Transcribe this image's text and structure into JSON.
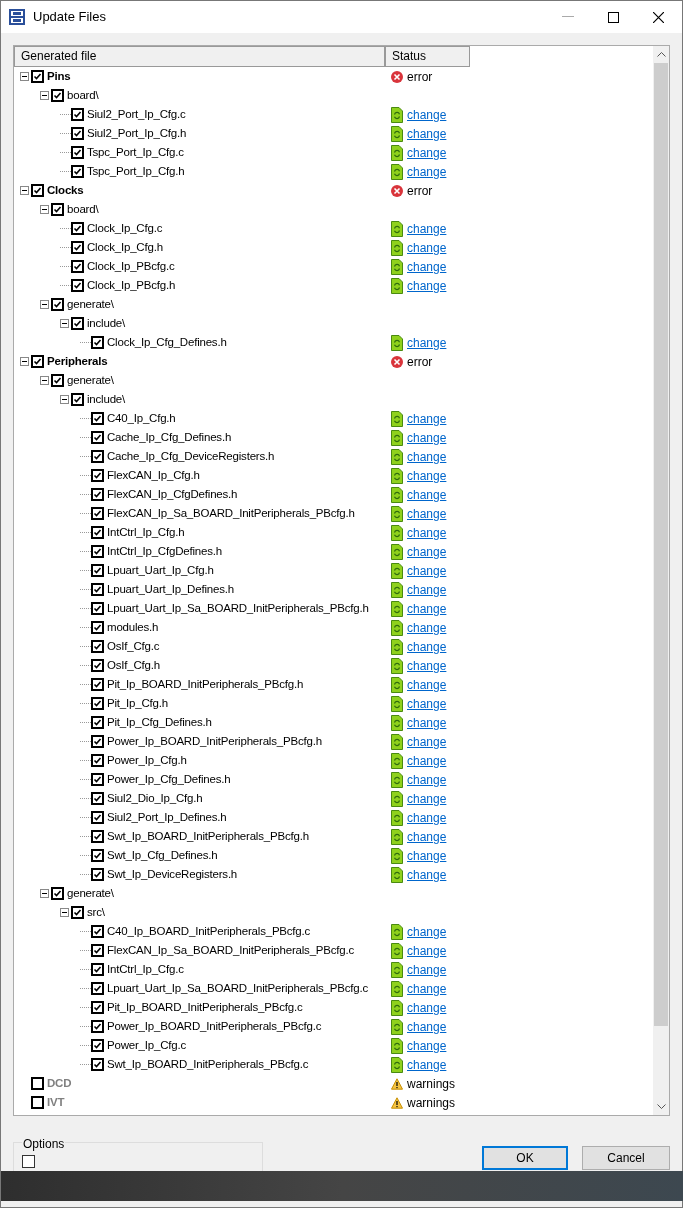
{
  "window": {
    "title": "Update Files"
  },
  "table": {
    "columns": [
      "Generated file",
      "Status"
    ],
    "rows": [
      {
        "label": "Pins",
        "checked": true,
        "disabled": false,
        "expanded": true,
        "status": {
          "kind": "error",
          "text": "error"
        },
        "children": [
          {
            "label": "board\\",
            "checked": true,
            "disabled": false,
            "expanded": true,
            "children": [
              {
                "label": "Siul2_Port_Ip_Cfg.c",
                "checked": true,
                "disabled": false,
                "status": {
                  "kind": "change",
                  "text": "change"
                }
              },
              {
                "label": "Siul2_Port_Ip_Cfg.h",
                "checked": true,
                "disabled": false,
                "status": {
                  "kind": "change",
                  "text": "change"
                }
              },
              {
                "label": "Tspc_Port_Ip_Cfg.c",
                "checked": true,
                "disabled": false,
                "status": {
                  "kind": "change",
                  "text": "change"
                }
              },
              {
                "label": "Tspc_Port_Ip_Cfg.h",
                "checked": true,
                "disabled": false,
                "status": {
                  "kind": "change",
                  "text": "change"
                }
              }
            ]
          }
        ]
      },
      {
        "label": "Clocks",
        "checked": true,
        "disabled": false,
        "expanded": true,
        "status": {
          "kind": "error",
          "text": "error"
        },
        "children": [
          {
            "label": "board\\",
            "checked": true,
            "disabled": false,
            "expanded": true,
            "children": [
              {
                "label": "Clock_Ip_Cfg.c",
                "checked": true,
                "disabled": false,
                "status": {
                  "kind": "change",
                  "text": "change"
                }
              },
              {
                "label": "Clock_Ip_Cfg.h",
                "checked": true,
                "disabled": false,
                "status": {
                  "kind": "change",
                  "text": "change"
                }
              },
              {
                "label": "Clock_Ip_PBcfg.c",
                "checked": true,
                "disabled": false,
                "status": {
                  "kind": "change",
                  "text": "change"
                }
              },
              {
                "label": "Clock_Ip_PBcfg.h",
                "checked": true,
                "disabled": false,
                "status": {
                  "kind": "change",
                  "text": "change"
                }
              }
            ]
          },
          {
            "label": "generate\\",
            "checked": true,
            "disabled": false,
            "expanded": true,
            "children": [
              {
                "label": "include\\",
                "checked": true,
                "disabled": false,
                "expanded": true,
                "children": [
                  {
                    "label": "Clock_Ip_Cfg_Defines.h",
                    "checked": true,
                    "disabled": false,
                    "status": {
                      "kind": "change",
                      "text": "change"
                    }
                  }
                ]
              }
            ]
          }
        ]
      },
      {
        "label": "Peripherals",
        "checked": true,
        "disabled": false,
        "expanded": true,
        "status": {
          "kind": "error",
          "text": "error"
        },
        "children": [
          {
            "label": "generate\\",
            "checked": true,
            "disabled": false,
            "expanded": true,
            "children": [
              {
                "label": "include\\",
                "checked": true,
                "disabled": false,
                "expanded": true,
                "children": [
                  {
                    "label": "C40_Ip_Cfg.h",
                    "checked": true,
                    "disabled": false,
                    "status": {
                      "kind": "change",
                      "text": "change"
                    }
                  },
                  {
                    "label": "Cache_Ip_Cfg_Defines.h",
                    "checked": true,
                    "disabled": false,
                    "status": {
                      "kind": "change",
                      "text": "change"
                    }
                  },
                  {
                    "label": "Cache_Ip_Cfg_DeviceRegisters.h",
                    "checked": true,
                    "disabled": false,
                    "status": {
                      "kind": "change",
                      "text": "change"
                    }
                  },
                  {
                    "label": "FlexCAN_Ip_Cfg.h",
                    "checked": true,
                    "disabled": false,
                    "status": {
                      "kind": "change",
                      "text": "change"
                    }
                  },
                  {
                    "label": "FlexCAN_Ip_CfgDefines.h",
                    "checked": true,
                    "disabled": false,
                    "status": {
                      "kind": "change",
                      "text": "change"
                    }
                  },
                  {
                    "label": "FlexCAN_Ip_Sa_BOARD_InitPeripherals_PBcfg.h",
                    "checked": true,
                    "disabled": false,
                    "status": {
                      "kind": "change",
                      "text": "change"
                    }
                  },
                  {
                    "label": "IntCtrl_Ip_Cfg.h",
                    "checked": true,
                    "disabled": false,
                    "status": {
                      "kind": "change",
                      "text": "change"
                    }
                  },
                  {
                    "label": "IntCtrl_Ip_CfgDefines.h",
                    "checked": true,
                    "disabled": false,
                    "status": {
                      "kind": "change",
                      "text": "change"
                    }
                  },
                  {
                    "label": "Lpuart_Uart_Ip_Cfg.h",
                    "checked": true,
                    "disabled": false,
                    "status": {
                      "kind": "change",
                      "text": "change"
                    }
                  },
                  {
                    "label": "Lpuart_Uart_Ip_Defines.h",
                    "checked": true,
                    "disabled": false,
                    "status": {
                      "kind": "change",
                      "text": "change"
                    }
                  },
                  {
                    "label": "Lpuart_Uart_Ip_Sa_BOARD_InitPeripherals_PBcfg.h",
                    "checked": true,
                    "disabled": false,
                    "status": {
                      "kind": "change",
                      "text": "change"
                    }
                  },
                  {
                    "label": "modules.h",
                    "checked": true,
                    "disabled": false,
                    "status": {
                      "kind": "change",
                      "text": "change"
                    }
                  },
                  {
                    "label": "OsIf_Cfg.c",
                    "checked": true,
                    "disabled": false,
                    "status": {
                      "kind": "change",
                      "text": "change"
                    }
                  },
                  {
                    "label": "OsIf_Cfg.h",
                    "checked": true,
                    "disabled": false,
                    "status": {
                      "kind": "change",
                      "text": "change"
                    }
                  },
                  {
                    "label": "Pit_Ip_BOARD_InitPeripherals_PBcfg.h",
                    "checked": true,
                    "disabled": false,
                    "status": {
                      "kind": "change",
                      "text": "change"
                    }
                  },
                  {
                    "label": "Pit_Ip_Cfg.h",
                    "checked": true,
                    "disabled": false,
                    "status": {
                      "kind": "change",
                      "text": "change"
                    }
                  },
                  {
                    "label": "Pit_Ip_Cfg_Defines.h",
                    "checked": true,
                    "disabled": false,
                    "status": {
                      "kind": "change",
                      "text": "change"
                    }
                  },
                  {
                    "label": "Power_Ip_BOARD_InitPeripherals_PBcfg.h",
                    "checked": true,
                    "disabled": false,
                    "status": {
                      "kind": "change",
                      "text": "change"
                    }
                  },
                  {
                    "label": "Power_Ip_Cfg.h",
                    "checked": true,
                    "disabled": false,
                    "status": {
                      "kind": "change",
                      "text": "change"
                    }
                  },
                  {
                    "label": "Power_Ip_Cfg_Defines.h",
                    "checked": true,
                    "disabled": false,
                    "status": {
                      "kind": "change",
                      "text": "change"
                    }
                  },
                  {
                    "label": "Siul2_Dio_Ip_Cfg.h",
                    "checked": true,
                    "disabled": false,
                    "status": {
                      "kind": "change",
                      "text": "change"
                    }
                  },
                  {
                    "label": "Siul2_Port_Ip_Defines.h",
                    "checked": true,
                    "disabled": false,
                    "status": {
                      "kind": "change",
                      "text": "change"
                    }
                  },
                  {
                    "label": "Swt_Ip_BOARD_InitPeripherals_PBcfg.h",
                    "checked": true,
                    "disabled": false,
                    "status": {
                      "kind": "change",
                      "text": "change"
                    }
                  },
                  {
                    "label": "Swt_Ip_Cfg_Defines.h",
                    "checked": true,
                    "disabled": false,
                    "status": {
                      "kind": "change",
                      "text": "change"
                    }
                  },
                  {
                    "label": "Swt_Ip_DeviceRegisters.h",
                    "checked": true,
                    "disabled": false,
                    "status": {
                      "kind": "change",
                      "text": "change"
                    }
                  }
                ]
              }
            ]
          },
          {
            "label": "generate\\",
            "checked": true,
            "disabled": false,
            "expanded": true,
            "children": [
              {
                "label": "src\\",
                "checked": true,
                "disabled": false,
                "expanded": true,
                "children": [
                  {
                    "label": "C40_Ip_BOARD_InitPeripherals_PBcfg.c",
                    "checked": true,
                    "disabled": false,
                    "status": {
                      "kind": "change",
                      "text": "change"
                    }
                  },
                  {
                    "label": "FlexCAN_Ip_Sa_BOARD_InitPeripherals_PBcfg.c",
                    "checked": true,
                    "disabled": false,
                    "status": {
                      "kind": "change",
                      "text": "change"
                    }
                  },
                  {
                    "label": "IntCtrl_Ip_Cfg.c",
                    "checked": true,
                    "disabled": false,
                    "status": {
                      "kind": "change",
                      "text": "change"
                    }
                  },
                  {
                    "label": "Lpuart_Uart_Ip_Sa_BOARD_InitPeripherals_PBcfg.c",
                    "checked": true,
                    "disabled": false,
                    "status": {
                      "kind": "change",
                      "text": "change"
                    }
                  },
                  {
                    "label": "Pit_Ip_BOARD_InitPeripherals_PBcfg.c",
                    "checked": true,
                    "disabled": false,
                    "status": {
                      "kind": "change",
                      "text": "change"
                    }
                  },
                  {
                    "label": "Power_Ip_BOARD_InitPeripherals_PBcfg.c",
                    "checked": true,
                    "disabled": false,
                    "status": {
                      "kind": "change",
                      "text": "change"
                    }
                  },
                  {
                    "label": "Power_Ip_Cfg.c",
                    "checked": true,
                    "disabled": false,
                    "status": {
                      "kind": "change",
                      "text": "change"
                    }
                  },
                  {
                    "label": "Swt_Ip_BOARD_InitPeripherals_PBcfg.c",
                    "checked": true,
                    "disabled": false,
                    "status": {
                      "kind": "change",
                      "text": "change"
                    }
                  }
                ]
              }
            ]
          }
        ]
      },
      {
        "label": "DCD",
        "checked": false,
        "disabled": true,
        "status": {
          "kind": "warning",
          "text": "warnings"
        }
      },
      {
        "label": "IVT",
        "checked": false,
        "disabled": true,
        "status": {
          "kind": "warning",
          "text": "warnings"
        }
      }
    ]
  },
  "options": {
    "title": "Options",
    "checkbox": {
      "checked": false
    }
  },
  "buttons": [
    {
      "label": "OK",
      "selected": true
    },
    {
      "label": "Cancel",
      "selected": false
    }
  ]
}
